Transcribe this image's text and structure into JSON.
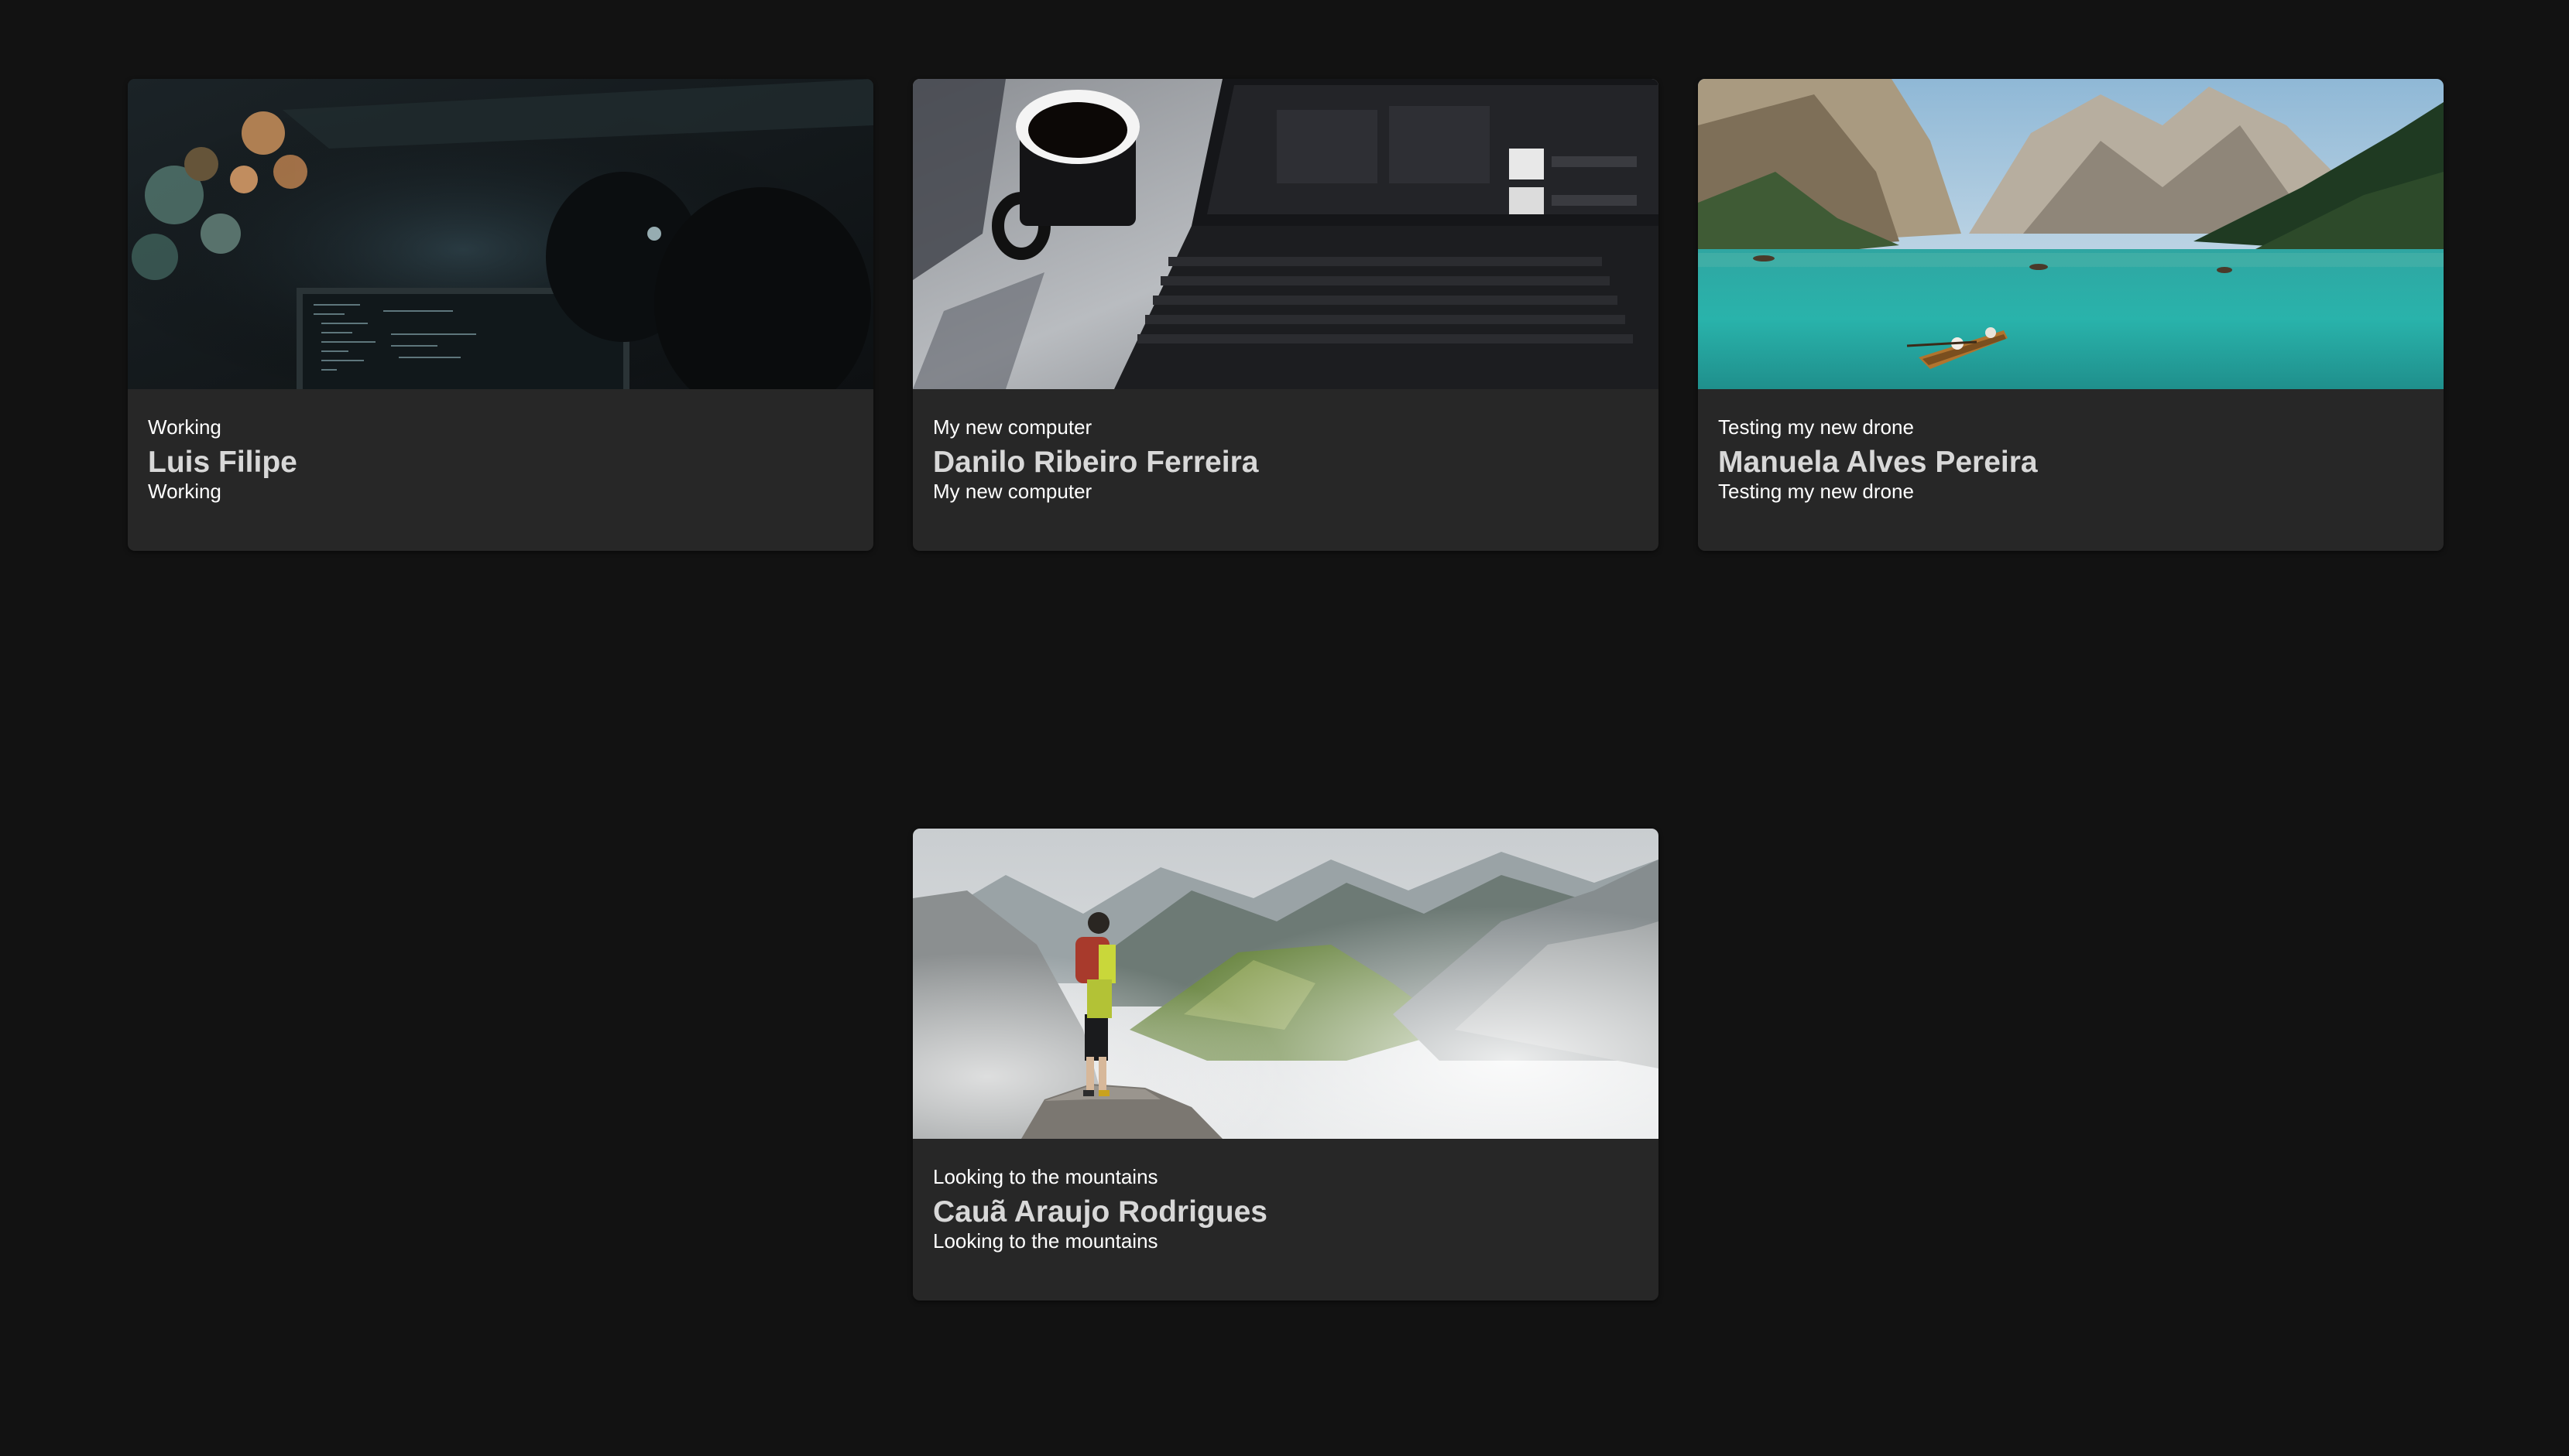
{
  "posts": [
    {
      "overline": "Working",
      "author": "Luis Filipe",
      "caption": "Working",
      "image_subject": "dark office with code on monitors"
    },
    {
      "overline": "My new computer",
      "author": "Danilo Ribeiro Ferreira",
      "caption": "My new computer",
      "image_subject": "coffee mug next to laptop on bed"
    },
    {
      "overline": "Testing my new drone",
      "author": "Manuela Alves Pereira",
      "caption": "Testing my new drone",
      "image_subject": "turquoise mountain lake with rowboat"
    },
    {
      "overline": "Looking to the mountains",
      "author": "Cauã Araujo Rodrigues",
      "caption": "Looking to the mountains",
      "image_subject": "hiker on cliff overlooking misty mountains"
    }
  ],
  "colors": {
    "page_background": "#121212",
    "card_background": "#272727",
    "title_text": "#d8d8d8",
    "body_text": "#ffffff"
  }
}
